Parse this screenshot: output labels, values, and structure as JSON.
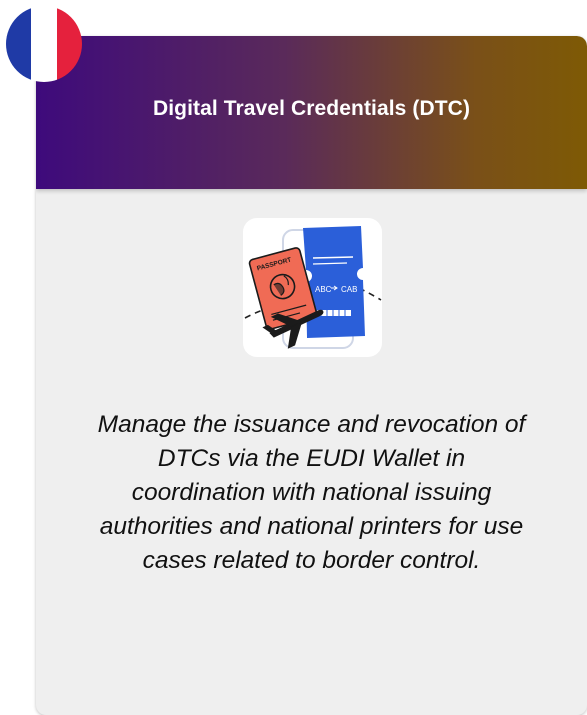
{
  "card": {
    "title": "Digital Travel Credentials (DTC)",
    "description_lines": [
      "Manage the issuance and revocation of",
      "DTCs via the EUDI Wallet in",
      "coordination with national issuing",
      "authorities and national printers for use",
      "cases related to border control."
    ]
  },
  "illustration": {
    "passport_text": "PASSPORT",
    "ticket_from": "ABC",
    "ticket_to": "CAB"
  },
  "flag": {
    "icon": "france-flag-icon",
    "colors": [
      "#1f3aa6",
      "#ffffff",
      "#e5213d"
    ]
  },
  "colors": {
    "header_gradient_start": "#3e0a7c",
    "header_gradient_end": "#7e5a05",
    "card_background": "#efefef",
    "ticket_blue": "#2b5fd9",
    "passport_red": "#f06b55"
  }
}
